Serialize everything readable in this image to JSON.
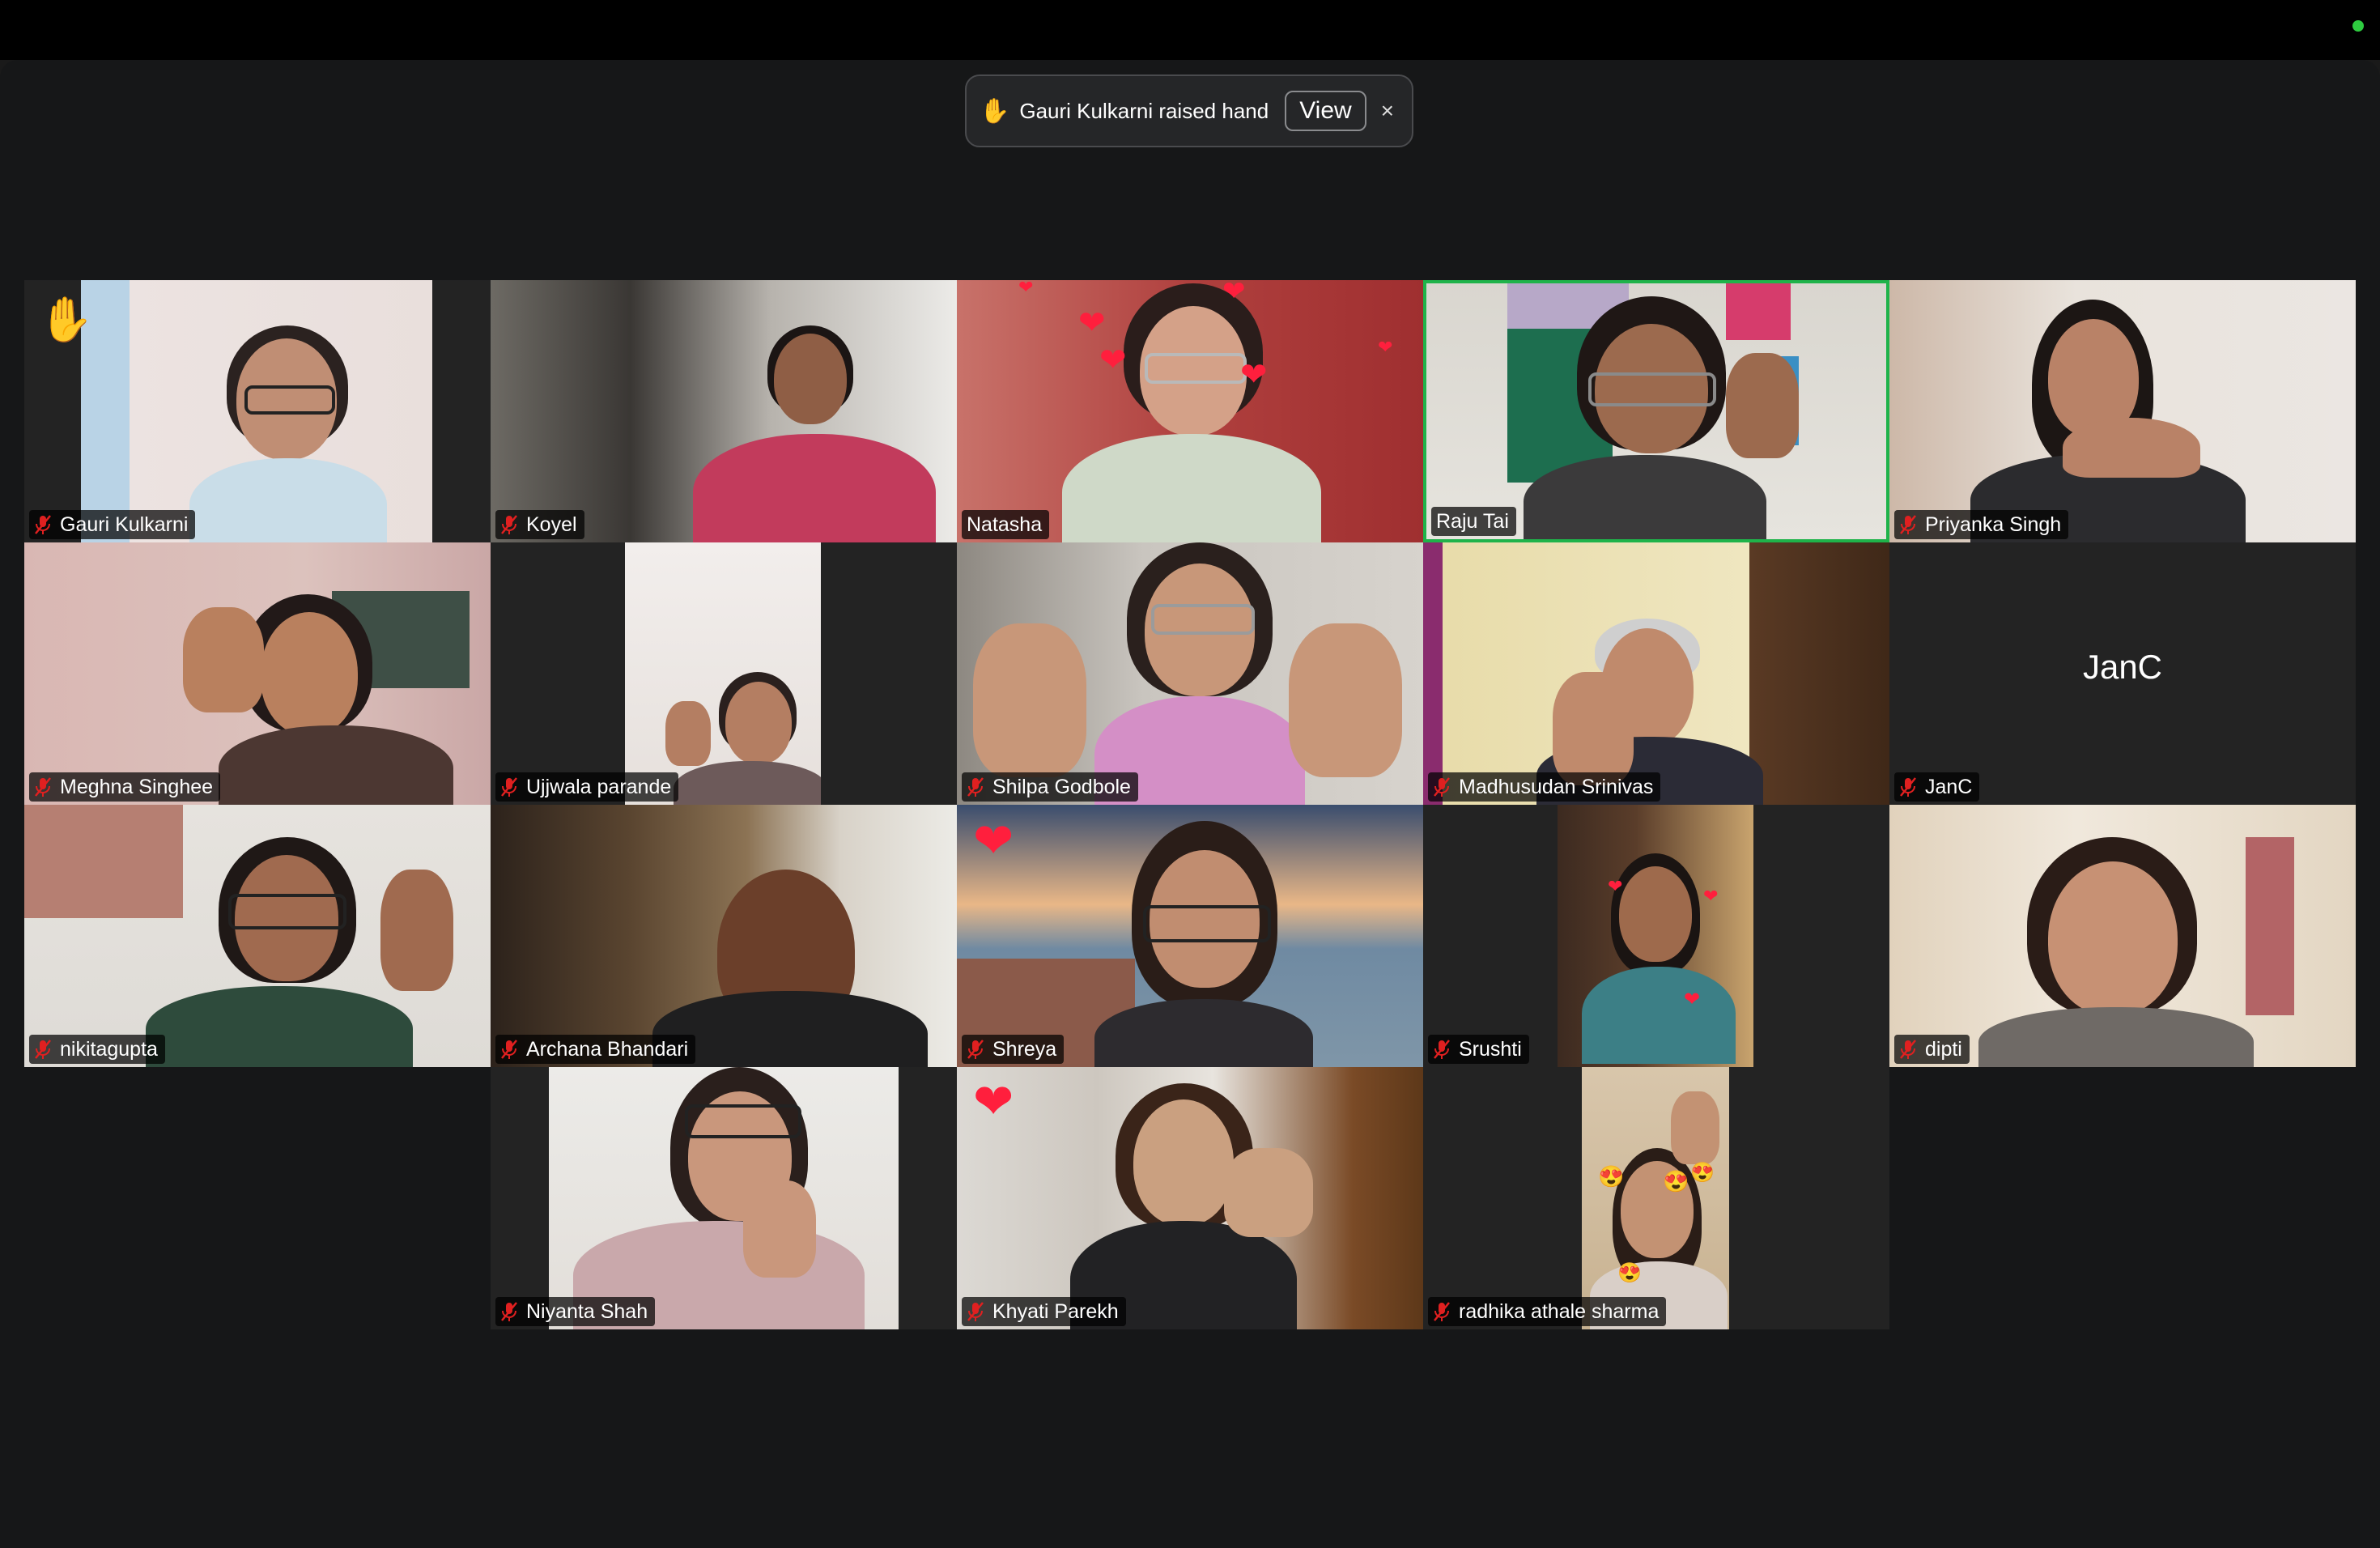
{
  "notification": {
    "hand_icon": "✋",
    "message": "Gauri Kulkarni raised hand",
    "view_label": "View",
    "close_label": "×"
  },
  "participants": [
    {
      "name": "Gauri Kulkarni",
      "raised_hand": true
    },
    {
      "name": "Koyel"
    },
    {
      "name": "Natasha",
      "muted": false
    },
    {
      "name": "Raju Tai",
      "muted": false,
      "active_speaker": true
    },
    {
      "name": "Priyanka Singh"
    },
    {
      "name": "Meghna Singhee"
    },
    {
      "name": "Ujjwala parande"
    },
    {
      "name": "Shilpa Godbole"
    },
    {
      "name": "Madhusudan Srinivas"
    },
    {
      "name": "JanC",
      "initials": "JanC",
      "video_off": true
    },
    {
      "name": "nikitagupta"
    },
    {
      "name": "Archana Bhandari"
    },
    {
      "name": "Shreya"
    },
    {
      "name": "Srushti"
    },
    {
      "name": "dipti"
    },
    {
      "name": "Niyanta Shah"
    },
    {
      "name": "Khyati Parekh"
    },
    {
      "name": "radhika athale sharma"
    }
  ],
  "colors": {
    "active_speaker_border": "#1fb34a",
    "muted_mic": "#e02020",
    "status_dot": "#2ecc40"
  }
}
